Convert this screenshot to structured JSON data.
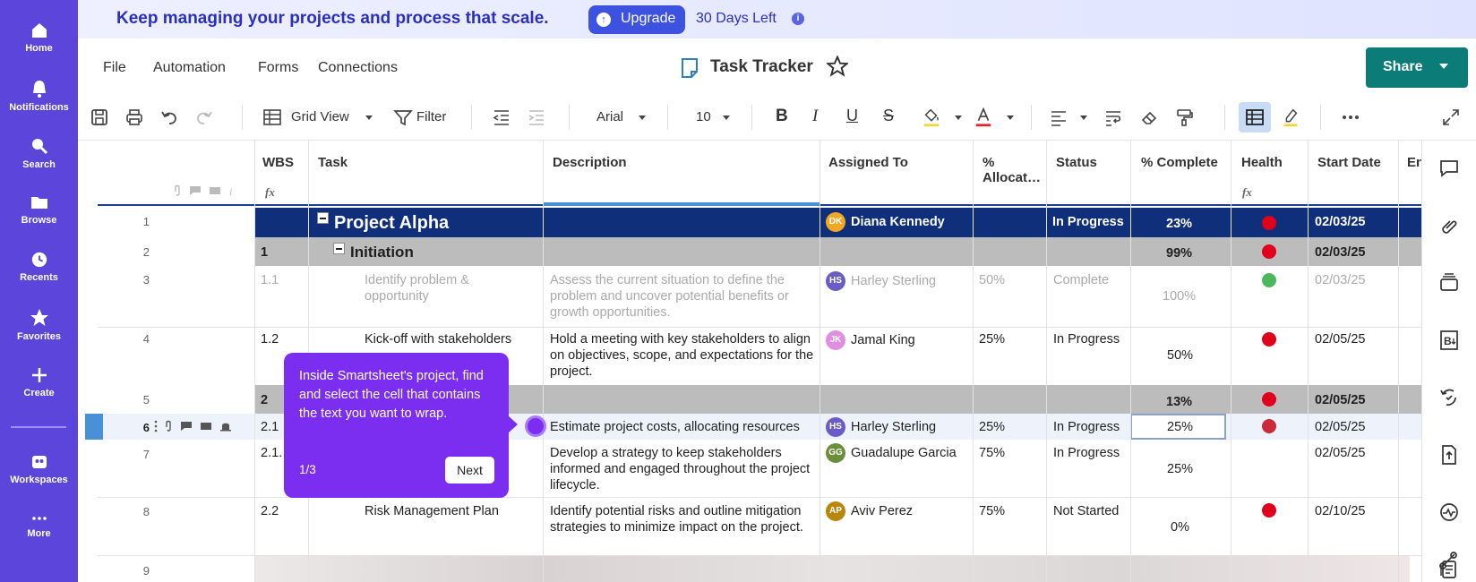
{
  "leftnav": {
    "items": [
      {
        "label": "Home",
        "icon": "home-icon"
      },
      {
        "label": "Notifications",
        "icon": "bell-icon"
      },
      {
        "label": "Search",
        "icon": "search-icon"
      },
      {
        "label": "Browse",
        "icon": "folder-icon"
      },
      {
        "label": "Recents",
        "icon": "clock-icon"
      },
      {
        "label": "Favorites",
        "icon": "star-icon"
      },
      {
        "label": "Create",
        "icon": "plus-icon"
      },
      {
        "label": "Workspaces",
        "icon": "workspaces-icon"
      },
      {
        "label": "More",
        "icon": "more-icon"
      }
    ]
  },
  "banner": {
    "text": "Keep managing your projects and process that scale.",
    "upgrade_label": "Upgrade",
    "days_left": "30 Days Left"
  },
  "menubar": {
    "items": [
      "File",
      "Automation",
      "Forms",
      "Connections"
    ],
    "doc_title": "Task Tracker",
    "share_label": "Share"
  },
  "toolbar": {
    "view_label": "Grid View",
    "filter_label": "Filter",
    "font_name": "Arial",
    "font_size": "10"
  },
  "grid": {
    "columns": {
      "wbs": "WBS",
      "task": "Task",
      "description": "Description",
      "assigned": "Assigned To",
      "alloc": "% Allocat…",
      "status": "Status",
      "complete": "% Complete",
      "health": "Health",
      "start": "Start Date",
      "end": "En"
    },
    "rows": [
      {
        "num": "1",
        "wbs": "",
        "task": "Project Alpha",
        "desc": "",
        "initials": "DK",
        "assigned": "Diana Kennedy",
        "alloc": "",
        "status": "In Progress",
        "complete": "23%",
        "health": "red",
        "start": "02/03/25"
      },
      {
        "num": "2",
        "wbs": "1",
        "task": "Initiation",
        "desc": "",
        "initials": "",
        "assigned": "",
        "alloc": "",
        "status": "",
        "complete": "99%",
        "health": "red",
        "start": "02/03/25"
      },
      {
        "num": "3",
        "wbs": "1.1",
        "task": "Identify problem & opportunity",
        "desc": "Assess the current situation to define the problem and uncover potential benefits or growth opportunities.",
        "initials": "HS",
        "assigned": "Harley Sterling",
        "alloc": "50%",
        "status": "Complete",
        "complete": "100%",
        "health": "green",
        "start": "02/03/25"
      },
      {
        "num": "4",
        "wbs": "1.2",
        "task": "Kick-off with stakeholders",
        "desc": "Hold a meeting with key stakeholders to align on objectives, scope, and expectations for the project.",
        "initials": "JK",
        "assigned": "Jamal King",
        "alloc": "25%",
        "status": "In Progress",
        "complete": "50%",
        "health": "red",
        "start": "02/05/25"
      },
      {
        "num": "5",
        "wbs": "2",
        "task": "",
        "desc": "",
        "initials": "",
        "assigned": "",
        "alloc": "",
        "status": "",
        "complete": "13%",
        "health": "red",
        "start": "02/05/25"
      },
      {
        "num": "6",
        "wbs": "2.1",
        "task": "",
        "desc": "Estimate project costs, allocating resources",
        "initials": "HS",
        "assigned": "Harley Sterling",
        "alloc": "25%",
        "status": "In Progress",
        "complete": "25%",
        "health": "red",
        "start": "02/05/25"
      },
      {
        "num": "7",
        "wbs": "2.1.",
        "task": "",
        "desc": "Develop a strategy to keep stakeholders informed and engaged throughout the project lifecycle.",
        "initials": "GG",
        "assigned": "Guadalupe Garcia",
        "alloc": "75%",
        "status": "In Progress",
        "complete": "25%",
        "health": "",
        "start": "02/05/25"
      },
      {
        "num": "8",
        "wbs": "2.2",
        "task": "Risk Management Plan",
        "desc": "Identify potential risks and outline mitigation strategies to minimize impact on the project.",
        "initials": "AP",
        "assigned": "Aviv Perez",
        "alloc": "75%",
        "status": "Not Started",
        "complete": "0%",
        "health": "red",
        "start": "02/10/25"
      },
      {
        "num": "9"
      }
    ]
  },
  "tooltip": {
    "text": "Inside Smartsheet's project, find and select the cell that contains the text you want to wrap.",
    "counter": "1/3",
    "next_label": "Next"
  },
  "colors": {
    "nav": "#5b45db",
    "share": "#0b7c78",
    "parent_row": "#0f2f7a",
    "group_row": "#bcbcbc",
    "tooltip": "#7c2ef0",
    "health_red": "#e0001b",
    "health_green": "#4cb85c"
  }
}
